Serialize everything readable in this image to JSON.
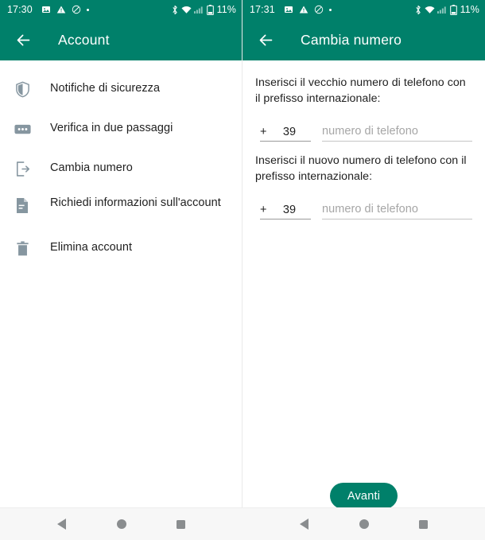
{
  "colors": {
    "header_green": "#00806a",
    "accent_button": "#00806a",
    "text_primary": "#1f1f1f",
    "placeholder": "#a6a6a6",
    "icon_grey": "#8696a0",
    "nav_grey": "#8a8d8f",
    "nav_bg": "#f7f7f7"
  },
  "left_pane": {
    "status_bar": {
      "clock": "17:30",
      "battery_text": "11%",
      "left_icons": [
        "image-icon",
        "warning-icon",
        "do-not-disturb-icon",
        "dot-icon"
      ],
      "right_icons": [
        "bluetooth-icon",
        "wifi-icon",
        "signal-icon",
        "battery-icon"
      ]
    },
    "appbar": {
      "back_icon": "arrow-back-icon",
      "title": "Account"
    },
    "items": [
      {
        "label": "Notifiche di sicurezza",
        "icon": "shield-icon",
        "two_line": false
      },
      {
        "label": "Verifica in due passaggi",
        "icon": "two-step-dots-icon",
        "two_line": false
      },
      {
        "label": "Cambia numero",
        "icon": "change-number-icon",
        "two_line": false
      },
      {
        "label": "Richiedi informazioni sull'account",
        "icon": "document-icon",
        "two_line": true
      },
      {
        "label": "Elimina account",
        "icon": "trash-icon",
        "two_line": false
      }
    ]
  },
  "right_pane": {
    "status_bar": {
      "clock": "17:31",
      "battery_text": "11%",
      "left_icons": [
        "image-icon",
        "warning-icon",
        "do-not-disturb-icon",
        "dot-icon"
      ],
      "right_icons": [
        "bluetooth-icon",
        "wifi-icon",
        "signal-icon",
        "battery-icon"
      ]
    },
    "appbar": {
      "back_icon": "arrow-back-icon",
      "title": "Cambia numero"
    },
    "old_number": {
      "instruction": "Inserisci il vecchio numero di telefono con il prefisso internazionale:",
      "country_prefix_symbol": "+",
      "country_code": "39",
      "phone_placeholder": "numero di telefono"
    },
    "new_number": {
      "instruction": "Inserisci il nuovo numero di telefono con il prefisso internazionale:",
      "country_prefix_symbol": "+",
      "country_code": "39",
      "phone_placeholder": "numero di telefono"
    },
    "next_button": "Avanti"
  },
  "nav_bar": {
    "buttons": [
      "back-triangle-icon",
      "home-circle-icon",
      "recents-square-icon"
    ]
  }
}
